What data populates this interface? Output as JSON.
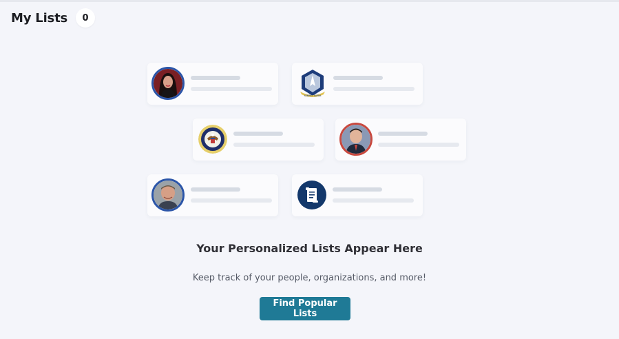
{
  "header": {
    "title": "My Lists",
    "count": "0"
  },
  "placeholder_cards": [
    {
      "icon": "person-avatar-icon",
      "ring_color": "#2b55a8"
    },
    {
      "icon": "space-force-seal-icon",
      "ring_color": "none"
    },
    {
      "icon": "presidential-seal-icon",
      "ring_color": "none"
    },
    {
      "icon": "person-avatar-icon",
      "ring_color": "#c8493f"
    },
    {
      "icon": "person-avatar-icon",
      "ring_color": "#2b55a8"
    },
    {
      "icon": "document-scroll-icon",
      "ring_color": "#13386b"
    }
  ],
  "empty_state": {
    "title": "Your Personalized Lists Appear Here",
    "subtitle": "Keep track of your people, organizations, and more!",
    "button_label": "Find Popular Lists"
  },
  "colors": {
    "accent": "#1f7a96",
    "background": "#f4f5fa"
  }
}
